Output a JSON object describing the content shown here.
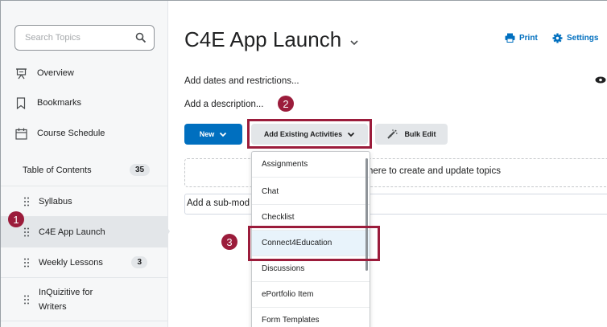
{
  "sidebar": {
    "search_placeholder": "Search Topics",
    "nav": [
      {
        "label": "Overview",
        "icon": "presentation-icon"
      },
      {
        "label": "Bookmarks",
        "icon": "bookmark-icon"
      },
      {
        "label": "Course Schedule",
        "icon": "calendar-icon"
      }
    ],
    "toc_label": "Table of Contents",
    "toc_count": "35",
    "toc_items": [
      {
        "label": "Syllabus"
      },
      {
        "label": "C4E App Launch",
        "selected": true
      },
      {
        "label": "Weekly Lessons",
        "count": "3"
      },
      {
        "label_line1": "InQuizitive for",
        "label_line2": "Writers"
      }
    ]
  },
  "main": {
    "title": "C4E App Launch",
    "print_label": "Print",
    "settings_label": "Settings",
    "dates_link": "Add dates and restrictions...",
    "description_link": "Add a description...",
    "new_button": "New",
    "add_existing_button": "Add Existing Activities",
    "bulk_edit_button": "Bulk Edit",
    "dropzone_text": "here to create and update topics",
    "submodule_text": "Add a sub-mod"
  },
  "dropdown": {
    "items": [
      "Assignments",
      "Chat",
      "Checklist",
      "Connect4Education",
      "Discussions",
      "ePortfolio Item",
      "Form Templates"
    ]
  },
  "callouts": [
    "1",
    "2",
    "3"
  ],
  "colors": {
    "accent": "#006fbf",
    "callout": "#9b1c3b",
    "sidebar_bg": "#f6f7f8"
  }
}
